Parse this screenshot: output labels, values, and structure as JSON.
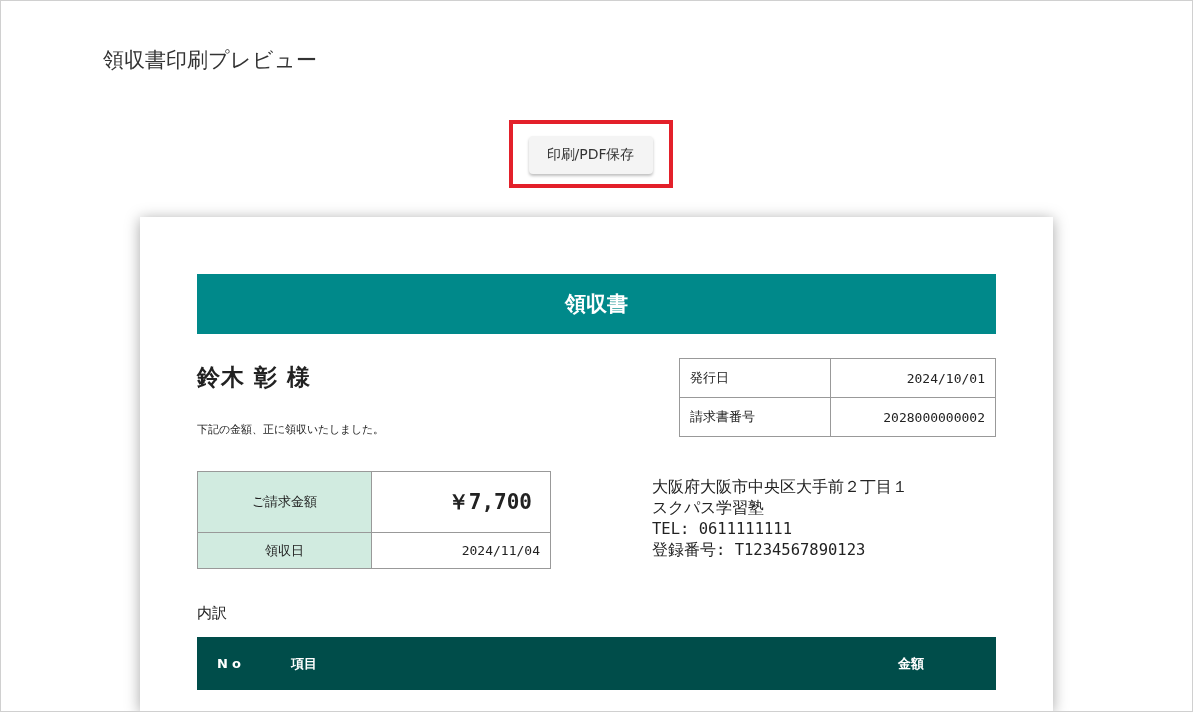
{
  "page_title": "領収書印刷プレビュー",
  "print_button": {
    "label": "印刷/PDF保存",
    "highlighted": true
  },
  "receipt": {
    "title": "領収書",
    "recipient": "鈴木 彰 様",
    "note": "下記の金額、正に領収いたしました。",
    "info": [
      {
        "label": "発行日",
        "value": "2024/10/01"
      },
      {
        "label": "請求書番号",
        "value": "2028000000002"
      }
    ],
    "amount": {
      "label": "ご請求金額",
      "value": "￥7,700"
    },
    "received": {
      "label": "領収日",
      "value": "2024/11/04"
    },
    "issuer_lines": [
      "大阪府大阪市中央区大手前２丁目１",
      "スクパス学習塾",
      "TEL: 0611111111",
      "登録番号: T1234567890123"
    ],
    "breakdown_label": "内訳",
    "columns": [
      "No",
      "項目",
      "金額"
    ]
  }
}
